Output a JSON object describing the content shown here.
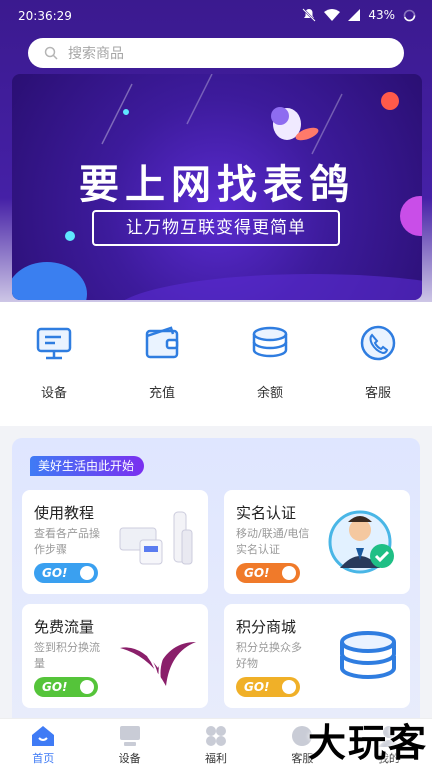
{
  "status": {
    "time": "20:36:29",
    "battery": "43%"
  },
  "search": {
    "placeholder": "搜索商品"
  },
  "banner": {
    "title": "要上网找表鸽",
    "subtitle": "让万物互联变得更简单"
  },
  "menu": [
    {
      "label": "设备",
      "icon": "monitor-icon"
    },
    {
      "label": "充值",
      "icon": "wallet-icon"
    },
    {
      "label": "余额",
      "icon": "coins-icon"
    },
    {
      "label": "客服",
      "icon": "phone-icon"
    }
  ],
  "life": {
    "tag": "美好生活由此开始",
    "cards": [
      {
        "title": "使用教程",
        "desc": "查看各产品操作步骤",
        "go": "GO!",
        "color": "#3aa0f0"
      },
      {
        "title": "实名认证",
        "desc": "移动/联通/电信实名认证",
        "go": "GO!",
        "color": "#f07a2a"
      },
      {
        "title": "免费流量",
        "desc": "签到积分换流量",
        "go": "GO!",
        "color": "#55c43a"
      },
      {
        "title": "积分商城",
        "desc": "积分兑换众多好物",
        "go": "GO!",
        "color": "#f0b028"
      }
    ]
  },
  "tabs": [
    {
      "label": "首页",
      "active": true
    },
    {
      "label": "设备"
    },
    {
      "label": "福利"
    },
    {
      "label": "客服"
    },
    {
      "label": "我的"
    }
  ],
  "watermark": "大玩客"
}
